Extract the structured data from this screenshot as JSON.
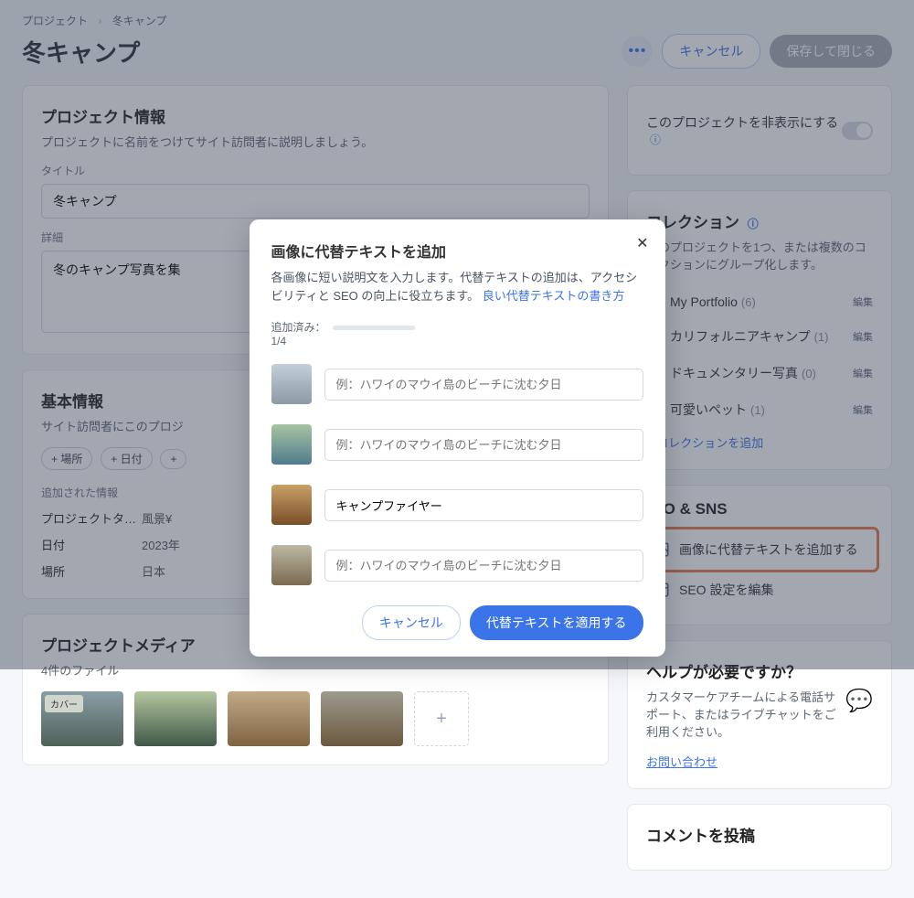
{
  "breadcrumb": {
    "root": "プロジェクト",
    "current": "冬キャンプ"
  },
  "page_title": "冬キャンプ",
  "header_actions": {
    "cancel": "キャンセル",
    "save_close": "保存して閉じる"
  },
  "project_info": {
    "heading": "プロジェクト情報",
    "sub": "プロジェクトに名前をつけてサイト訪問者に説明しましょう。",
    "title_label": "タイトル",
    "title_value": "冬キャンプ",
    "desc_label": "詳細",
    "desc_value": "冬のキャンプ写真を集"
  },
  "basic_info": {
    "heading": "基本情報",
    "sub": "サイト訪問者にこのプロジ",
    "pills": {
      "place": "+ 場所",
      "date": "+ 日付",
      "more": "+"
    },
    "added_label": "追加された情報",
    "rows": {
      "tag_k": "プロジェクトタ…",
      "tag_v": "風景¥",
      "date_k": "日付",
      "date_v": "2023年",
      "place_k": "場所",
      "place_v": "日本"
    }
  },
  "media": {
    "heading": "プロジェクトメディア",
    "count": "4件のファイル",
    "cover": "カバー"
  },
  "visibility": {
    "label": "このプロジェクトを非表示にする"
  },
  "collections": {
    "heading": "コレクション",
    "sub": "このプロジェクトを1つ、または複数のコレクションにグループ化します。",
    "items": [
      {
        "name": "My Portfolio",
        "count": "(6)",
        "checked": false
      },
      {
        "name": "カリフォルニアキャンプ",
        "count": "(1)",
        "checked": true
      },
      {
        "name": "ドキュメンタリー写真",
        "count": "(0)",
        "checked": false
      },
      {
        "name": "可愛いペット",
        "count": "(1)",
        "checked": false
      }
    ],
    "edit": "編集",
    "add": "+  コレクションを追加"
  },
  "seo": {
    "heading": "SEO & SNS",
    "alt_text": "画像に代替テキストを追加する",
    "settings": "SEO 設定を編集"
  },
  "help": {
    "heading": "ヘルプが必要ですか？",
    "body": "カスタマーケアチームによる電話サポート、またはライブチャットをご利用ください。",
    "link": "お問い合わせ"
  },
  "comments": {
    "heading": "コメントを投稿"
  },
  "modal": {
    "title": "画像に代替テキストを追加",
    "desc_a": "各画像に短い説明文を入力します。代替テキストの追加は、アクセシビリティと SEO の向上に役立ちます。",
    "desc_link": "良い代替テキストの書き方",
    "progress_label": "追加済み：",
    "progress_count": "1/4",
    "placeholder": "例：ハワイのマウイ島のビーチに沈む夕日",
    "value3": "キャンプファイヤー",
    "cancel": "キャンセル",
    "apply": "代替テキストを適用する"
  }
}
